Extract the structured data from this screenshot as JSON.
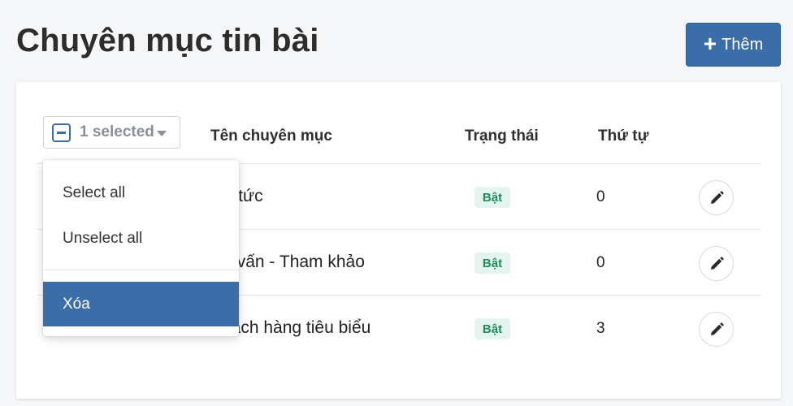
{
  "header": {
    "title": "Chuyên mục tin bài",
    "add_label": "Thêm",
    "add_icon": "plus-icon"
  },
  "bulk": {
    "selected_label": "1 selected",
    "menu": {
      "select_all": "Select all",
      "unselect_all": "Unselect all",
      "delete": "Xóa"
    }
  },
  "table": {
    "columns": {
      "name": "Tên chuyên mục",
      "status": "Trạng thái",
      "order": "Thứ tự"
    },
    "rows": [
      {
        "name": "Tin tức",
        "status": "Bật",
        "order": "0"
      },
      {
        "name": "Tư vấn - Tham khảo",
        "status": "Bật",
        "order": "0"
      },
      {
        "name": "Khách hàng tiêu biểu",
        "status": "Bật",
        "order": "3"
      }
    ]
  },
  "colors": {
    "accent": "#3b6ea8",
    "badge_bg": "#e3f5ee",
    "badge_text": "#1f8a5a"
  }
}
